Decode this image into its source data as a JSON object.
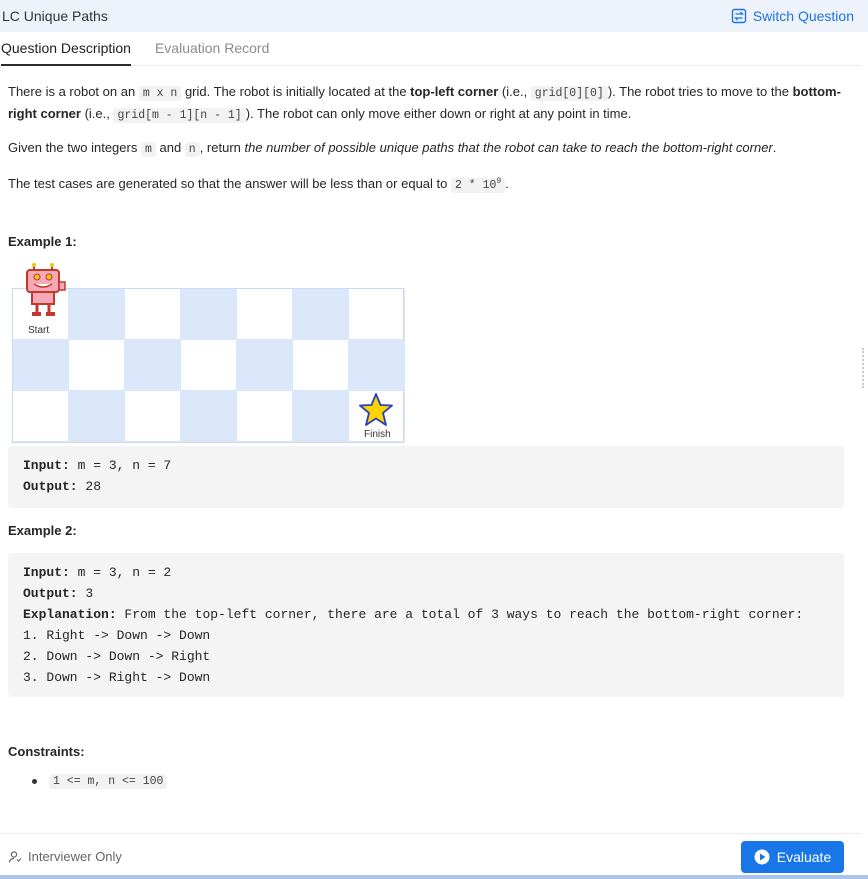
{
  "header": {
    "title": "LC  Unique Paths",
    "switch_label": "Switch Question"
  },
  "tabs": [
    {
      "label": "Question Description",
      "active": true
    },
    {
      "label": "Evaluation Record",
      "active": false
    }
  ],
  "description": {
    "p1": {
      "t1": "There is a robot on an ",
      "c1": "m x n",
      "t2": " grid. The robot is initially located at the ",
      "b1": "top-left corner",
      "t3": " (i.e., ",
      "c2": "grid[0][0]",
      "t4": "). The robot tries to move to the ",
      "b2": "bottom-right corner",
      "t5": " (i.e., ",
      "c3": "grid[m - 1][n - 1]",
      "t6": "). The robot can only move either down or right at any point in time."
    },
    "p2": {
      "t1": "Given the two integers ",
      "c1": "m",
      "t2": " and ",
      "c2": "n",
      "t3": ", return ",
      "i1": "the number of possible unique paths that the robot can take to reach the bottom-right corner",
      "t4": "."
    },
    "p3": {
      "t1": "The test cases are generated so that the answer will be less than or equal to ",
      "c1": "2 * 10",
      "sup": "9",
      "t2": "."
    }
  },
  "example1": {
    "heading": "Example 1:",
    "start_label": "Start",
    "finish_label": "Finish",
    "input_label": "Input:",
    "input_value": " m = 3, n = 7",
    "output_label": "Output:",
    "output_value": " 28"
  },
  "example2": {
    "heading": "Example 2:",
    "input_label": "Input:",
    "input_value": " m = 3, n = 2",
    "output_label": "Output:",
    "output_value": " 3",
    "explanation_label": "Explanation:",
    "explanation_value": " From the top-left corner, there are a total of 3 ways to reach the bottom-right corner:",
    "lines": [
      "1. Right -> Down -> Down",
      "2. Down -> Down -> Right",
      "3. Down -> Right -> Down"
    ]
  },
  "constraints": {
    "heading": "Constraints:",
    "item": "1 <= m, n <= 100"
  },
  "footer": {
    "interviewer_label": "Interviewer Only",
    "evaluate_label": "Evaluate"
  },
  "colors": {
    "accent": "#1976e8",
    "grid_blue": "#dbe7fb",
    "star": "#ffd400"
  }
}
